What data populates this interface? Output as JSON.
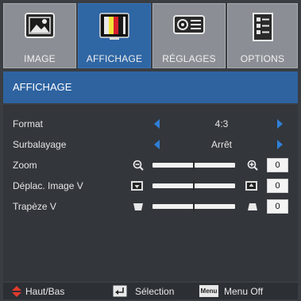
{
  "tabs": [
    {
      "label": "IMAGE",
      "icon": "picture-icon"
    },
    {
      "label": "AFFICHAGE",
      "icon": "display-color-bars-icon",
      "active": true
    },
    {
      "label": "RÉGLAGES",
      "icon": "projector-icon"
    },
    {
      "label": "OPTIONS",
      "icon": "options-list-icon"
    }
  ],
  "header": {
    "title": "AFFICHAGE"
  },
  "settings": [
    {
      "name": "Format",
      "value": "4:3"
    },
    {
      "name": "Surbalayage",
      "value": "Arrêt"
    },
    {
      "name": "Zoom",
      "value": "0",
      "level_percent": 50
    },
    {
      "name": "Déplac. Image V",
      "value": "0",
      "level_percent": 50
    },
    {
      "name": "Trapèze V",
      "value": "0",
      "level_percent": 50
    }
  ],
  "footer": {
    "nav_label": "Haut/Bas",
    "select_label": "Sélection",
    "menu_key": "Menu",
    "menu_label": "Menu Off"
  },
  "colors": {
    "accent": "#2f66a4",
    "arrow": "#2f7fd6",
    "nav_arrow": "#e23a2e",
    "background": "#3a3d42"
  }
}
